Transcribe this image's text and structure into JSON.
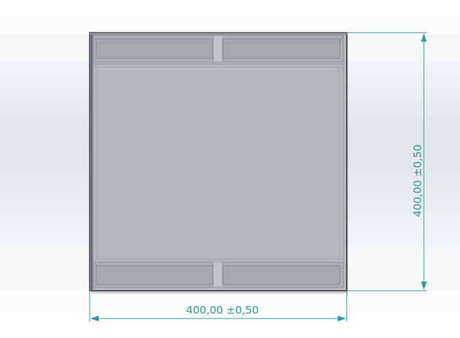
{
  "view": {
    "title": ""
  },
  "dimensions": {
    "horizontal": "400,00 ±0,50",
    "vertical": "400,00 ±0,50"
  },
  "colors": {
    "dimension": "#2b9c98",
    "part_face": "#b6b9bc",
    "part_edge": "#2a2a2a",
    "channel_fill": "#a9acaf",
    "divider": "#c2c5c8"
  }
}
